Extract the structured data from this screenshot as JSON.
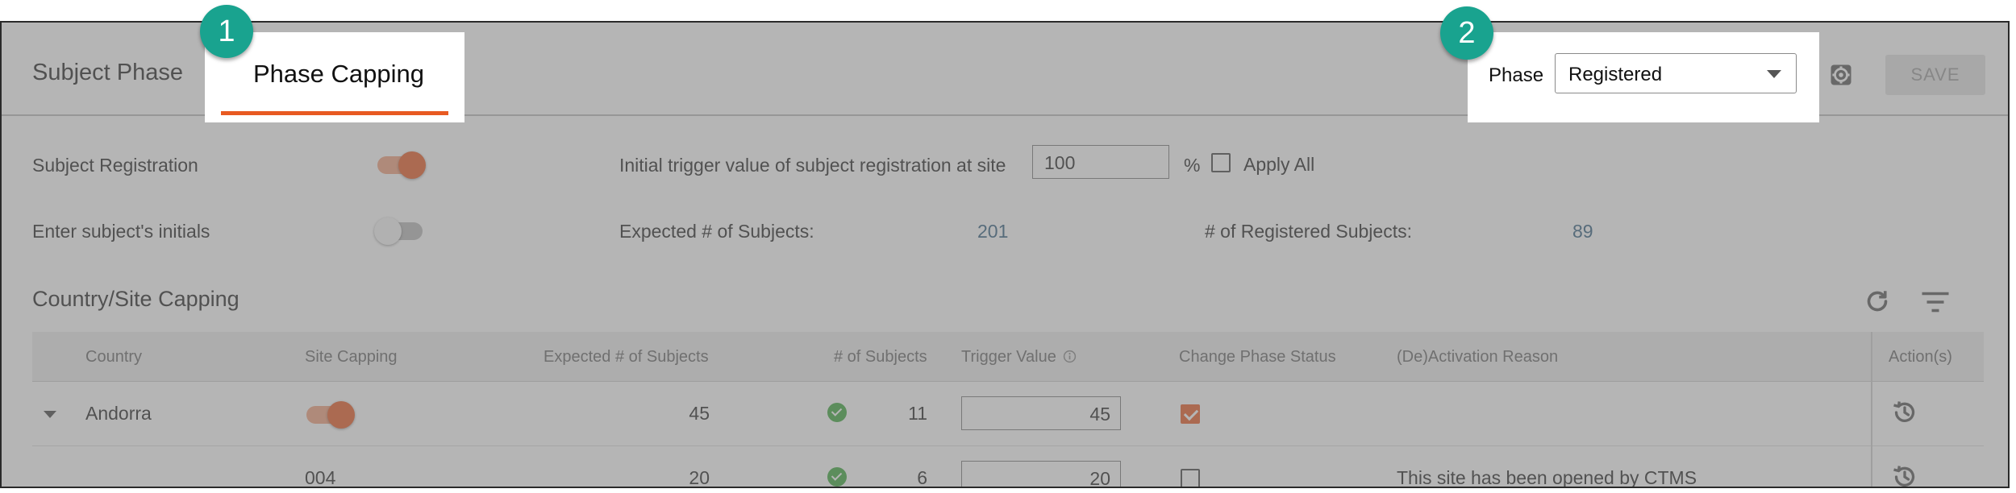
{
  "header": {
    "tab_subject_phase": "Subject Phase",
    "tab_phase_capping": "Phase Capping",
    "phase_label": "Phase",
    "phase_value": "Registered",
    "save_label": "SAVE"
  },
  "badges": {
    "one": "1",
    "two": "2"
  },
  "settings": {
    "subject_registration_label": "Subject Registration",
    "subject_registration_on": true,
    "enter_initials_label": "Enter subject's initials",
    "enter_initials_on": false,
    "trigger_label": "Initial trigger value of subject registration at site",
    "trigger_value": "100",
    "percent": "%",
    "apply_all_label": "Apply All",
    "expected_label": "Expected # of Subjects:",
    "expected_value": "201",
    "registered_label": "# of Registered Subjects:",
    "registered_value": "89"
  },
  "table": {
    "title": "Country/Site Capping",
    "columns": {
      "country": "Country",
      "site_capping": "Site Capping",
      "expected": "Expected # of Subjects",
      "subjects": "# of Subjects",
      "trigger": "Trigger Value",
      "change_status": "Change Phase Status",
      "reason": "(De)Activation Reason",
      "actions": "Action(s)"
    },
    "rows": [
      {
        "country": "Andorra",
        "site_capping_on": true,
        "expected": "45",
        "subjects": "11",
        "trigger": "45",
        "change_status_checked": true,
        "reason": ""
      },
      {
        "site": "004",
        "expected": "20",
        "subjects": "6",
        "trigger": "20",
        "change_status_checked": false,
        "reason": "This site has been opened by CTMS"
      }
    ]
  },
  "colors": {
    "accent": "#e85a22",
    "badge": "#19a38f",
    "link": "#2f5d7e",
    "success": "#3aa63a"
  },
  "icons": [
    "gear-icon",
    "refresh-icon",
    "filter-icon",
    "info-icon",
    "history-icon",
    "chevron-down-icon",
    "check-circle-icon"
  ]
}
